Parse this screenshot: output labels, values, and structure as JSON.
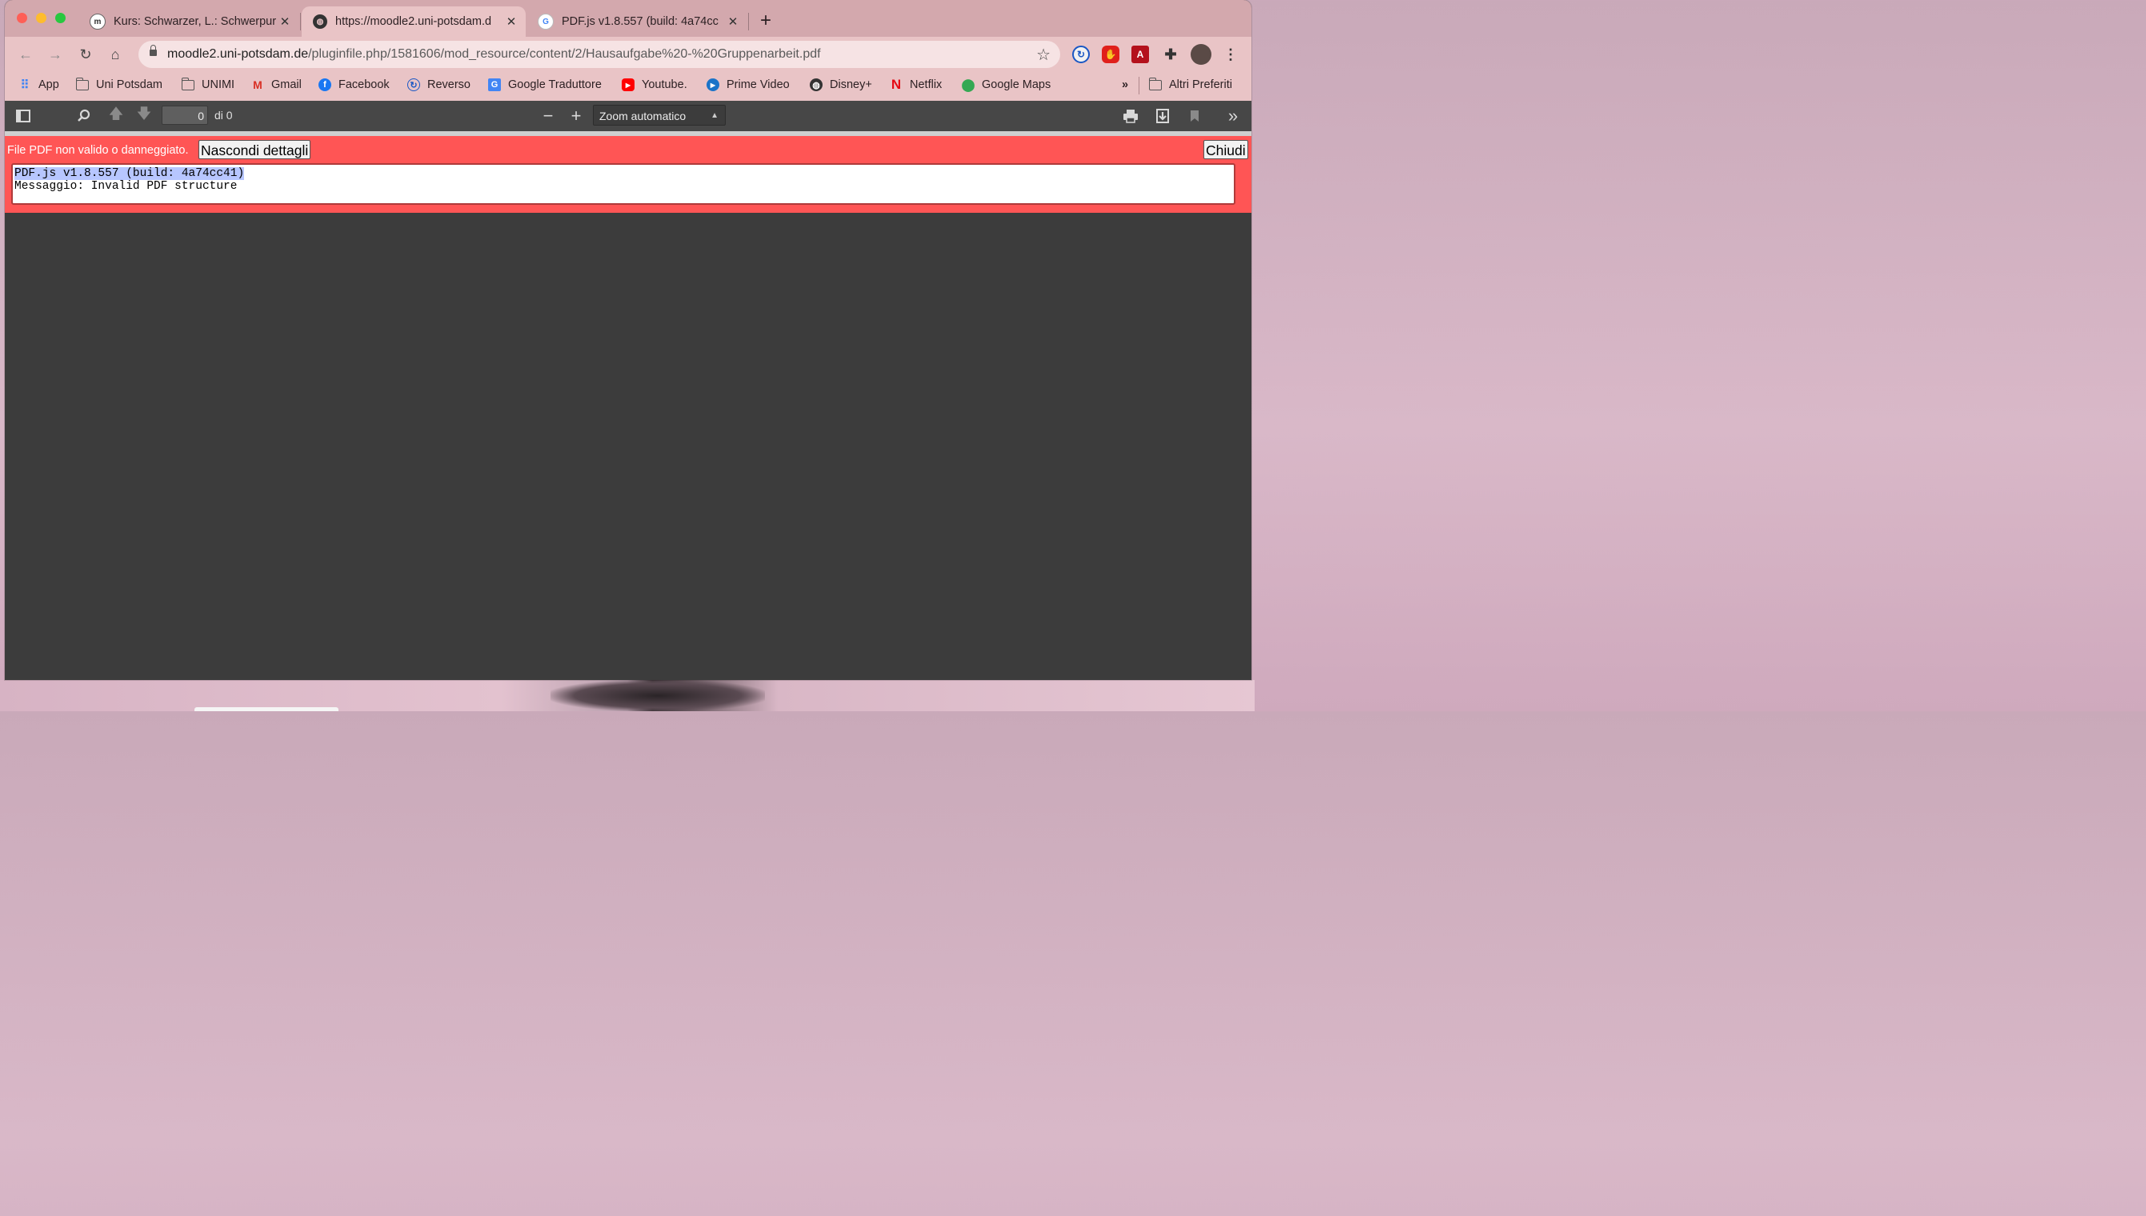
{
  "tabs": [
    {
      "title": "Kurs: Schwarzer, L.: Schwerpur",
      "favicon": "moodle-icon",
      "active": false
    },
    {
      "title": "https://moodle2.uni-potsdam.d",
      "favicon": "globe-icon",
      "active": true
    },
    {
      "title": "PDF.js v1.8.557 (build: 4a74cc",
      "favicon": "google-icon",
      "active": false
    }
  ],
  "address": {
    "host": "moodle2.uni-potsdam.de",
    "path": "/pluginfile.php/1581606/mod_resource/content/2/Hausaufgabe%20-%20Gruppenarbeit.pdf"
  },
  "bookmarks": {
    "items": [
      "App",
      "Uni Potsdam",
      "UNIMI",
      "Gmail",
      "Facebook",
      "Reverso",
      "Google Traduttore",
      "Youtube.",
      "Prime Video",
      "Disney+",
      "Netflix",
      "Google Maps"
    ],
    "overflow": "»",
    "other": "Altri Preferiti"
  },
  "pdf_toolbar": {
    "page_value": "0",
    "page_count": "di 0",
    "zoom": "Zoom automatico"
  },
  "error": {
    "message": "File PDF non valido o danneggiato.",
    "toggle_label": "Nascondi dettagli",
    "close_label": "Chiudi",
    "detail_line1": "PDF.js v1.8.557 (build: 4a74cc41)",
    "detail_line2": "Messaggio: Invalid PDF structure"
  },
  "colors": {
    "error_bar": "#ff5555",
    "tab_strip": "#d3a8ad",
    "toolbar": "#e9c4c6",
    "pdf_toolbar": "#474747",
    "viewer_bg": "#3c3c3c"
  }
}
